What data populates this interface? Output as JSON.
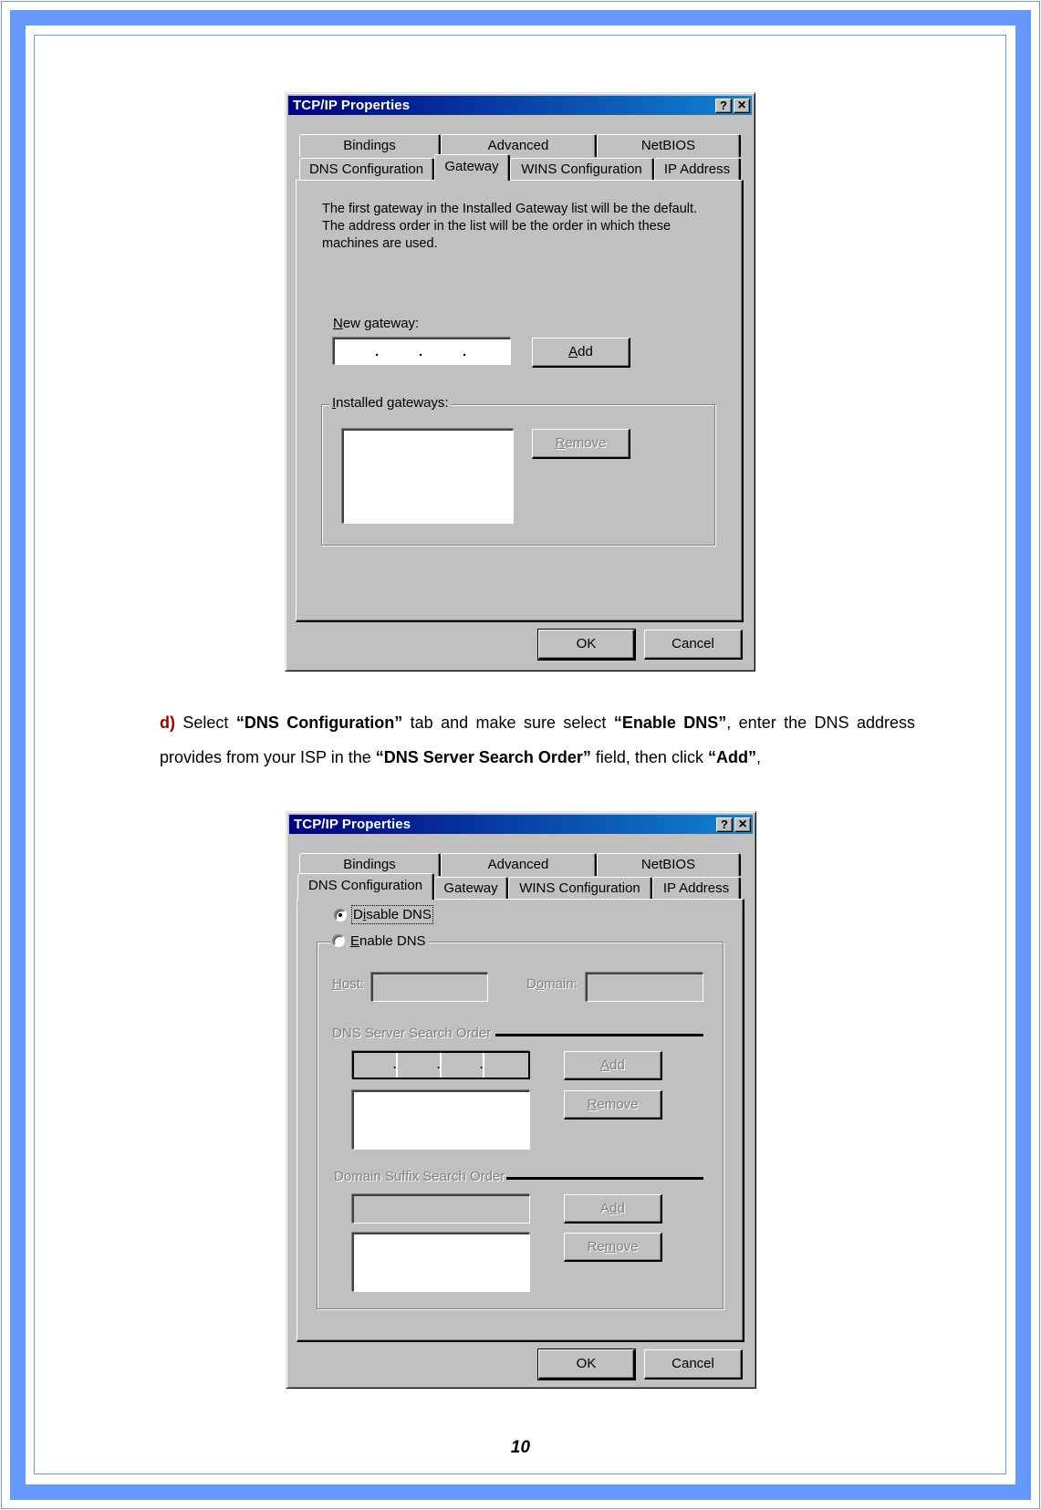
{
  "document": {
    "page_number": "10",
    "frame_color": "#6699ff",
    "step": {
      "marker": "d)",
      "text_parts": [
        {
          "text": " Select ",
          "bold": false
        },
        {
          "text": "“DNS Configuration”",
          "bold": true
        },
        {
          "text": " tab and make sure select ",
          "bold": false
        },
        {
          "text": "“Enable DNS”",
          "bold": true
        },
        {
          "text": ", enter the DNS address provides from your ISP in the ",
          "bold": false
        },
        {
          "text": "“DNS Server Search Order”",
          "bold": true
        },
        {
          "text": " field, then click ",
          "bold": false
        },
        {
          "text": "“Add”",
          "bold": true
        },
        {
          "text": ",",
          "bold": false
        }
      ]
    }
  },
  "dialog1": {
    "title": "TCP/IP Properties",
    "help_button": "?",
    "close_button": "×",
    "tabs_row1": [
      "Bindings",
      "Advanced",
      "NetBIOS"
    ],
    "tabs_row2": [
      "DNS Configuration",
      "Gateway",
      "WINS Configuration",
      "IP Address"
    ],
    "active_tab": "Gateway",
    "description": [
      "The first gateway in the Installed Gateway list will be the default.",
      "The address order in the list will be the order in which these",
      "machines are used."
    ],
    "new_gateway_label_ul": "N",
    "new_gateway_label_rest": "ew gateway:",
    "new_gateway_value": ".       .       .",
    "add_button_ul": "A",
    "add_button_rest": "dd",
    "installed_label_ul": "I",
    "installed_label_rest": "nstalled gateways:",
    "installed_gateways": [],
    "remove_button_ul": "R",
    "remove_button_rest": "emove",
    "ok_label": "OK",
    "cancel_label": "Cancel"
  },
  "dialog2": {
    "title": "TCP/IP Properties",
    "help_button": "?",
    "close_button": "×",
    "tabs_row1": [
      "Bindings",
      "Advanced",
      "NetBIOS"
    ],
    "tabs_row2": [
      "DNS Configuration",
      "Gateway",
      "WINS Configuration",
      "IP Address"
    ],
    "active_tab": "DNS Configuration",
    "disable_dns": {
      "pre": "D",
      "ul": "i",
      "post": "sable DNS",
      "selected": true
    },
    "enable_dns": {
      "ul": "E",
      "post": "nable DNS",
      "selected": false
    },
    "host_label": {
      "ul": "H",
      "post": "ost:"
    },
    "host_value": "",
    "domain_label": {
      "pre": "D",
      "ul": "o",
      "post": "main:"
    },
    "domain_value": "",
    "dns_server_search_order_label": "DNS Server Search Order",
    "dns_ip_value": ".     .     .",
    "dns_servers": [],
    "dns_add": {
      "ul": "A",
      "post": "dd"
    },
    "dns_remove": {
      "ul": "R",
      "post": "emove"
    },
    "domain_suffix_label": "Domain Suffix Search Order",
    "suffix_value": "",
    "suffixes": [],
    "suffix_add": {
      "pre": "A",
      "ul": "d",
      "post": "d"
    },
    "suffix_remove": {
      "pre": "Re",
      "ul": "m",
      "post": "ove"
    },
    "ok_label": "OK",
    "cancel_label": "Cancel"
  }
}
